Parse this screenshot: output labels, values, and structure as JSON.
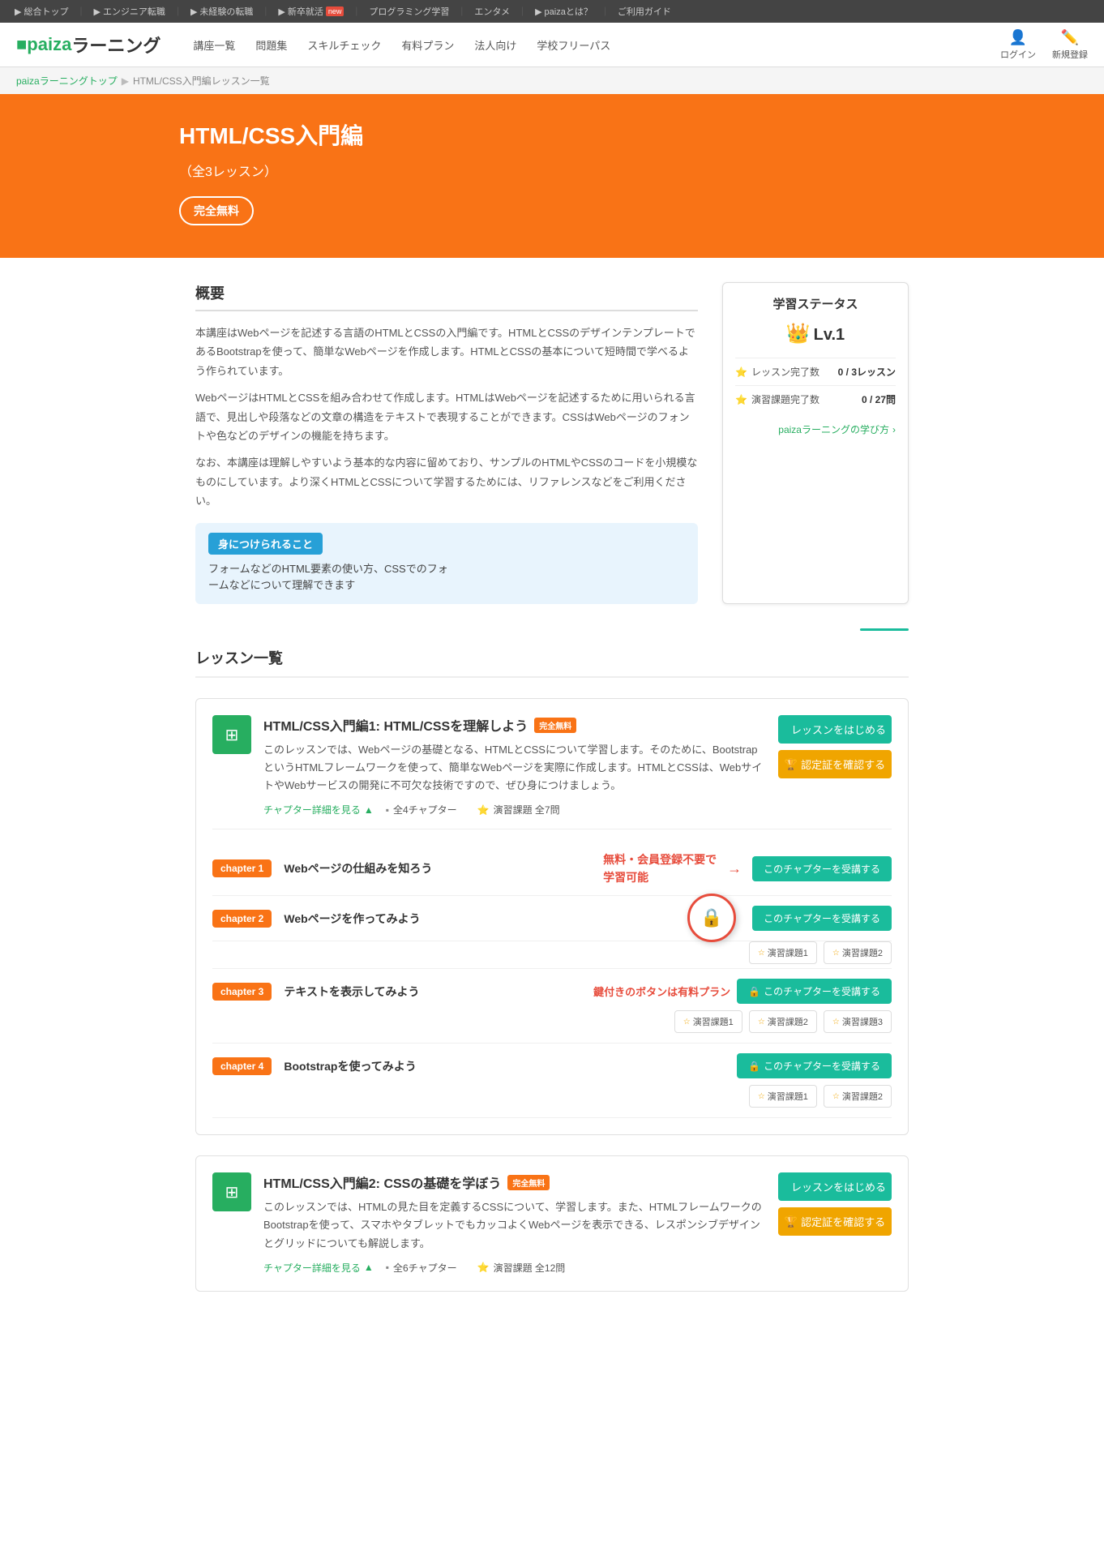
{
  "topNav": {
    "items": [
      {
        "label": "総合トップ",
        "url": "#"
      },
      {
        "label": "エンジニア転職",
        "url": "#"
      },
      {
        "label": "未経験の転職",
        "url": "#"
      },
      {
        "label": "新卒就活",
        "url": "#",
        "badge": "new"
      },
      {
        "label": "プログラミング学習",
        "url": "#"
      },
      {
        "label": "エンタメ",
        "url": "#"
      },
      {
        "label": "paizaとは？",
        "url": "#"
      },
      {
        "label": "ご利用ガイド",
        "url": "#"
      }
    ]
  },
  "header": {
    "logo": "paiza",
    "logoSuffix": "ラーニング",
    "nav": [
      {
        "label": "講座一覧"
      },
      {
        "label": "問題集"
      },
      {
        "label": "スキルチェック"
      },
      {
        "label": "有料プラン"
      },
      {
        "label": "法人向け"
      },
      {
        "label": "学校フリーパス"
      }
    ],
    "actions": [
      {
        "label": "ログイン",
        "icon": "👤"
      },
      {
        "label": "新規登録",
        "icon": "✏️"
      }
    ]
  },
  "breadcrumb": {
    "items": [
      {
        "label": "paizaラーニングトップ",
        "url": "#"
      },
      {
        "label": "HTML/CSS入門編レッスン一覧"
      }
    ]
  },
  "hero": {
    "title": "HTML/CSS入門編",
    "subtitle": "（全3レッスン）",
    "badge": "完全無料"
  },
  "overview": {
    "title": "概要",
    "paragraphs": [
      "本講座はWebページを記述する言語のHTMLとCSSの入門編です。HTMLとCSSのデザインテンプレートであるBootstrapを使って、簡単なWebページを作成します。HTMLとCSSの基本について短時間で学べるよう作られています。",
      "WebページはHTMLとCSSを組み合わせて作成します。HTMLはWebページを記述するために用いられる言語で、見出しや段落などの文章の構造をテキストで表現することができます。CSSはWebページのフォントや色などのデザインの機能を持ちます。",
      "なお、本講座は理解しやすいよう基本的な内容に留めており、サンプルのHTMLやCSSのコードを小規模なものにしています。より深くHTMLとCSSについて学習するためには、リファレンスなどをご利用ください。"
    ],
    "skillsBox": {
      "title": "身につけられること",
      "content": "フォームなどのHTML要素の使い方、CSSでのフォ\nームなどについて理解できます"
    }
  },
  "statusCard": {
    "title": "学習ステータス",
    "level": "Lv.1",
    "levelIcon": "👑",
    "lessonComplete": "0 / 3レッスン",
    "lessonLabel": "レッスン完了数",
    "exerciseComplete": "0 / 27問",
    "exerciseLabel": "演習課題完了数",
    "learnLink": "paizaラーニングの学び方"
  },
  "lessonList": {
    "title": "レッスン一覧",
    "lessons": [
      {
        "id": 1,
        "title": "HTML/CSS入門編1: HTML/CSSを理解しよう",
        "free": true,
        "freeLabel": "完全無料",
        "description": "このレッスンでは、Webページの基礎となる、HTMLとCSSについて学習します。そのために、BootstrapというHTMLフレームワークを使って、簡単なWebページを実際に作成します。HTMLとCSSは、WebサイトやWebサービスの開発に不可欠な技術ですので、ぜひ身につけましょう。",
        "chapterCount": "全4チャプター",
        "exerciseCount": "演習課題 全7問",
        "startBtn": "レッスンをはじめる",
        "certBtn": "🏆 認定証を確認する",
        "toggleLabel": "チャプター詳細を見る",
        "chapters": [
          {
            "id": 1,
            "badge": "chapter 1",
            "name": "Webページの仕組みを知ろう",
            "free": true,
            "freeText": "無料・会員登録不要で",
            "freeTextSub": "学習可能",
            "btn": "このチャプターを受講する",
            "locked": false,
            "exercises": []
          },
          {
            "id": 2,
            "badge": "chapter 2",
            "name": "Webページを作ってみよう",
            "free": false,
            "btn": "このチャプターを受講する",
            "locked": false,
            "exercises": [
              "演習課題1",
              "演習課題2"
            ]
          },
          {
            "id": 3,
            "badge": "chapter 3",
            "name": "テキストを表示してみよう",
            "free": false,
            "btn": "このチャプターを受講する",
            "locked": true,
            "lockText": "鍵付きのボタンは有料プラン",
            "exercises": [
              "演習課題1",
              "演習課題2",
              "演習課題3"
            ]
          },
          {
            "id": 4,
            "badge": "chapter 4",
            "name": "Bootstrapを使ってみよう",
            "free": false,
            "btn": "このチャプターを受講する",
            "locked": true,
            "exercises": [
              "演習課題1",
              "演習課題2"
            ]
          }
        ]
      },
      {
        "id": 2,
        "title": "HTML/CSS入門編2: CSSの基礎を学ぼう",
        "free": true,
        "freeLabel": "完全無料",
        "description": "このレッスンでは、HTMLの見た目を定義するCSSについて、学習します。また、HTMLフレームワークのBootstrapを使って、スマホやタブレットでもカッコよくWebページを表示できる、レスポンシブデザインとグリッドについても解説します。",
        "chapterCount": "全6チャプター",
        "exerciseCount": "演習課題 全12問",
        "startBtn": "レッスンをはじめる",
        "certBtn": "🏆 認定証を確認する",
        "toggleLabel": "チャプター詳細を見る"
      }
    ]
  }
}
